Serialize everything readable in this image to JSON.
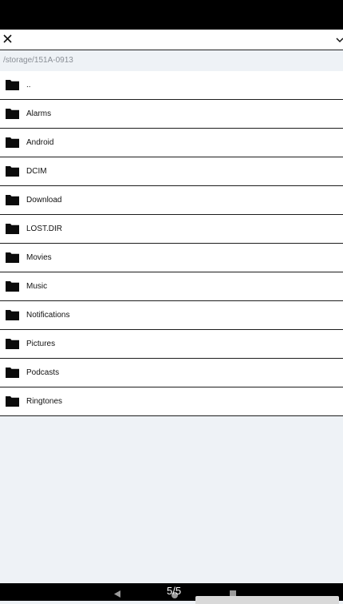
{
  "path": "/storage/151A-0913",
  "files": [
    {
      "name": ".."
    },
    {
      "name": "Alarms"
    },
    {
      "name": "Android"
    },
    {
      "name": "DCIM"
    },
    {
      "name": "Download"
    },
    {
      "name": "LOST.DIR"
    },
    {
      "name": "Movies"
    },
    {
      "name": "Music"
    },
    {
      "name": "Notifications"
    },
    {
      "name": "Pictures"
    },
    {
      "name": "Podcasts"
    },
    {
      "name": "Ringtones"
    }
  ],
  "nav": {
    "page_indicator": "5/5"
  },
  "icons": {
    "close": "close-icon",
    "menu": "chevron-down-icon",
    "folder": "folder-icon"
  },
  "colors": {
    "background": "#eef2f6",
    "row": "#ffffff",
    "divider": "#1c1c1c",
    "bars": "#000000"
  }
}
